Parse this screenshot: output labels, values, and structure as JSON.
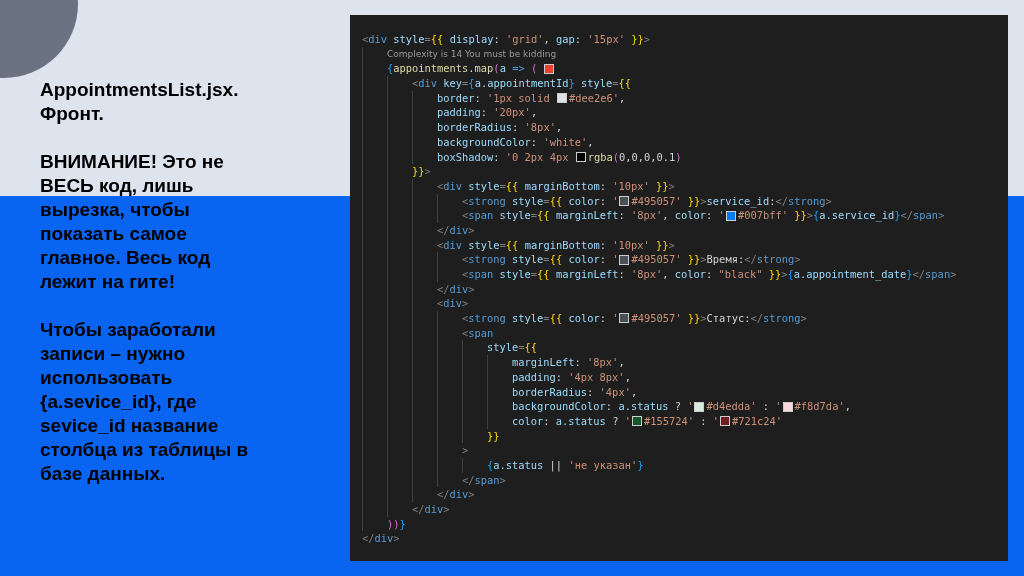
{
  "slide_text": [
    {
      "lines": [
        "AppointmentsList.jsx.",
        "Фронт."
      ]
    },
    {
      "lines": [
        "ВНИМАНИЕ!  Это не",
        "ВЕСЬ код, лишь",
        "вырезка, чтобы",
        "показать самое",
        "главное. Весь код",
        "лежит на гите!"
      ]
    },
    {
      "lines": [
        "Чтобы заработали",
        "записи – нужно",
        "использовать",
        "{a.sevice_id}, где",
        "sevice_id название",
        "столбца из таблицы в",
        "базе данных."
      ]
    }
  ],
  "code_lines": [
    {
      "kind": "code",
      "parts": [
        {
          "text": "<div style={{ display: 'grid', gap: '15px' }}>"
        }
      ]
    },
    {
      "kind": "lens",
      "parts": [
        {
          "text": "    Complexity is 14 You must be kidding"
        }
      ]
    },
    {
      "kind": "code",
      "parts": [
        {
          "text": "    {appointments.map(a => ( "
        },
        {
          "color": "#e8412f"
        }
      ]
    },
    {
      "kind": "code",
      "parts": [
        {
          "text": "        <div key={a.appointmentId} style={{"
        }
      ]
    },
    {
      "kind": "code",
      "parts": [
        {
          "text": "            border: '1px solid "
        },
        {
          "color": "#dee2e6"
        },
        {
          "text": "#dee2e6',"
        }
      ]
    },
    {
      "kind": "code",
      "parts": [
        {
          "text": "            padding: '20px',"
        }
      ]
    },
    {
      "kind": "code",
      "parts": [
        {
          "text": "            borderRadius: '8px',"
        }
      ]
    },
    {
      "kind": "code",
      "parts": [
        {
          "text": "            backgroundColor: 'white',"
        }
      ]
    },
    {
      "kind": "code",
      "parts": [
        {
          "text": "            boxShadow: '0 2px 4px "
        },
        {
          "color": "#000000"
        },
        {
          "text": "rgba(0,0,0,0.1)"
        }
      ]
    },
    {
      "kind": "code",
      "parts": [
        {
          "text": "        }}>"
        }
      ]
    },
    {
      "kind": "code",
      "parts": [
        {
          "text": "            <div style={{ marginBottom: '10px' }}>"
        }
      ]
    },
    {
      "kind": "code",
      "parts": [
        {
          "text": "                <strong style={{ color: '"
        },
        {
          "color": "#495057"
        },
        {
          "text": "#495057' }}>service_id:</strong>"
        }
      ]
    },
    {
      "kind": "code",
      "parts": [
        {
          "text": "                <span style={{ marginLeft: '8px', color: '"
        },
        {
          "color": "#007bff"
        },
        {
          "text": "#007bff' }}>{a.service_id}</span>"
        }
      ]
    },
    {
      "kind": "code",
      "parts": [
        {
          "text": "            </div>"
        }
      ]
    },
    {
      "kind": "code",
      "parts": [
        {
          "text": "            <div style={{ marginBottom: '10px' }}>"
        }
      ]
    },
    {
      "kind": "code",
      "parts": [
        {
          "text": "                <strong style={{ color: '"
        },
        {
          "color": "#495057"
        },
        {
          "text": "#495057' }}>Время:</strong>"
        }
      ]
    },
    {
      "kind": "code",
      "parts": [
        {
          "text": "                <span style={{ marginLeft: '8px', color: \"black\" }}>{a.appointment_date}</span>"
        }
      ]
    },
    {
      "kind": "code",
      "parts": [
        {
          "text": "            </div>"
        }
      ]
    },
    {
      "kind": "code",
      "parts": [
        {
          "text": "            <div>"
        }
      ]
    },
    {
      "kind": "code",
      "parts": [
        {
          "text": "                <strong style={{ color: '"
        },
        {
          "color": "#495057"
        },
        {
          "text": "#495057' }}>Статус:</strong>"
        }
      ]
    },
    {
      "kind": "code",
      "parts": [
        {
          "text": "                <span"
        }
      ]
    },
    {
      "kind": "code",
      "parts": [
        {
          "text": "                    style={{"
        }
      ]
    },
    {
      "kind": "code",
      "parts": [
        {
          "text": "                        marginLeft: '8px',"
        }
      ]
    },
    {
      "kind": "code",
      "parts": [
        {
          "text": "                        padding: '4px 8px',"
        }
      ]
    },
    {
      "kind": "code",
      "parts": [
        {
          "text": "                        borderRadius: '4px',"
        }
      ]
    },
    {
      "kind": "code",
      "parts": [
        {
          "text": "                        backgroundColor: a.status ? '"
        },
        {
          "color": "#d4edda"
        },
        {
          "text": "#d4edda' : '"
        },
        {
          "color": "#f8d7da"
        },
        {
          "text": "#f8d7da',"
        }
      ]
    },
    {
      "kind": "code",
      "parts": [
        {
          "text": "                        color: a.status ? '"
        },
        {
          "color": "#155724"
        },
        {
          "text": "#155724' : '"
        },
        {
          "color": "#721c24"
        },
        {
          "text": "#721c24'"
        }
      ]
    },
    {
      "kind": "code",
      "parts": [
        {
          "text": "                    }}"
        }
      ]
    },
    {
      "kind": "code",
      "parts": [
        {
          "text": "                >"
        }
      ]
    },
    {
      "kind": "code",
      "parts": [
        {
          "text": "                    {a.status || 'не указан'}"
        }
      ]
    },
    {
      "kind": "code",
      "parts": [
        {
          "text": "                </span>"
        }
      ]
    },
    {
      "kind": "code",
      "parts": [
        {
          "text": "            </div>"
        }
      ]
    },
    {
      "kind": "code",
      "parts": [
        {
          "text": "        </div>"
        }
      ]
    },
    {
      "kind": "code",
      "parts": [
        {
          "text": "    ))}"
        }
      ]
    },
    {
      "kind": "code",
      "parts": [
        {
          "text": "</div>"
        }
      ]
    }
  ]
}
